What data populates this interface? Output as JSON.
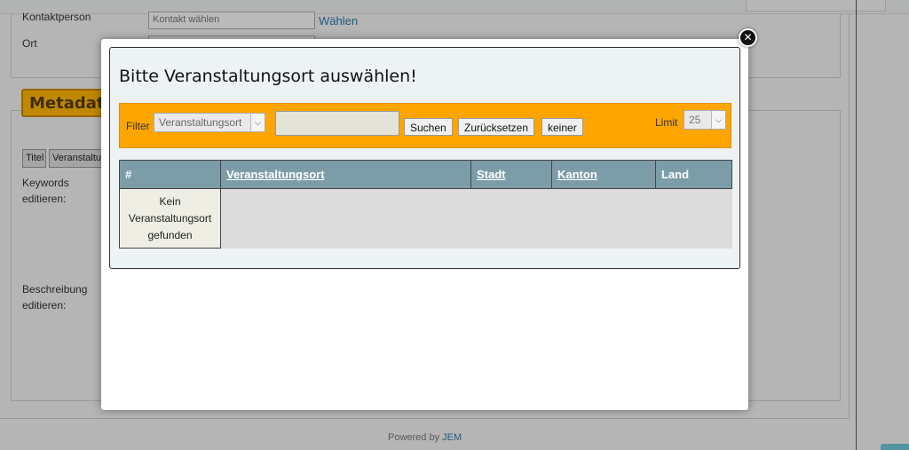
{
  "background": {
    "fields": [
      {
        "label": "Kontaktperson",
        "value": "Kontakt wählen",
        "link": "Wählen"
      },
      {
        "label": "Ort",
        "value": "",
        "link": ""
      }
    ],
    "metadata_tab": "Metadaten",
    "tag_buttons": [
      "Titel",
      "Veranstaltung"
    ],
    "keywords_label": [
      "Keywords",
      "editieren:"
    ],
    "description_label": [
      "Beschreibung",
      "editieren:"
    ],
    "footer": {
      "prefix": "Powered by ",
      "brand": "JEM"
    }
  },
  "modal": {
    "title": "Bitte Veranstaltungsort auswählen!",
    "filter": {
      "label": "Filter",
      "selected": "Veranstaltungsort",
      "input_value": "",
      "buttons": {
        "search": "Suchen",
        "reset": "Zurücksetzen",
        "none": "keiner"
      },
      "limit_label": "Limit",
      "limit_value": "25"
    },
    "table": {
      "columns": [
        "#",
        "Veranstaltungsort",
        "Stadt",
        "Kanton",
        "Land"
      ],
      "empty_message": [
        "Kein",
        "Veranstaltungsort",
        "gefunden"
      ]
    }
  },
  "colors": {
    "filter_bar": "#ffa500",
    "table_header": "#7c9da8",
    "link": "#2a7ab0",
    "metadata_tab": "#ffb600"
  }
}
